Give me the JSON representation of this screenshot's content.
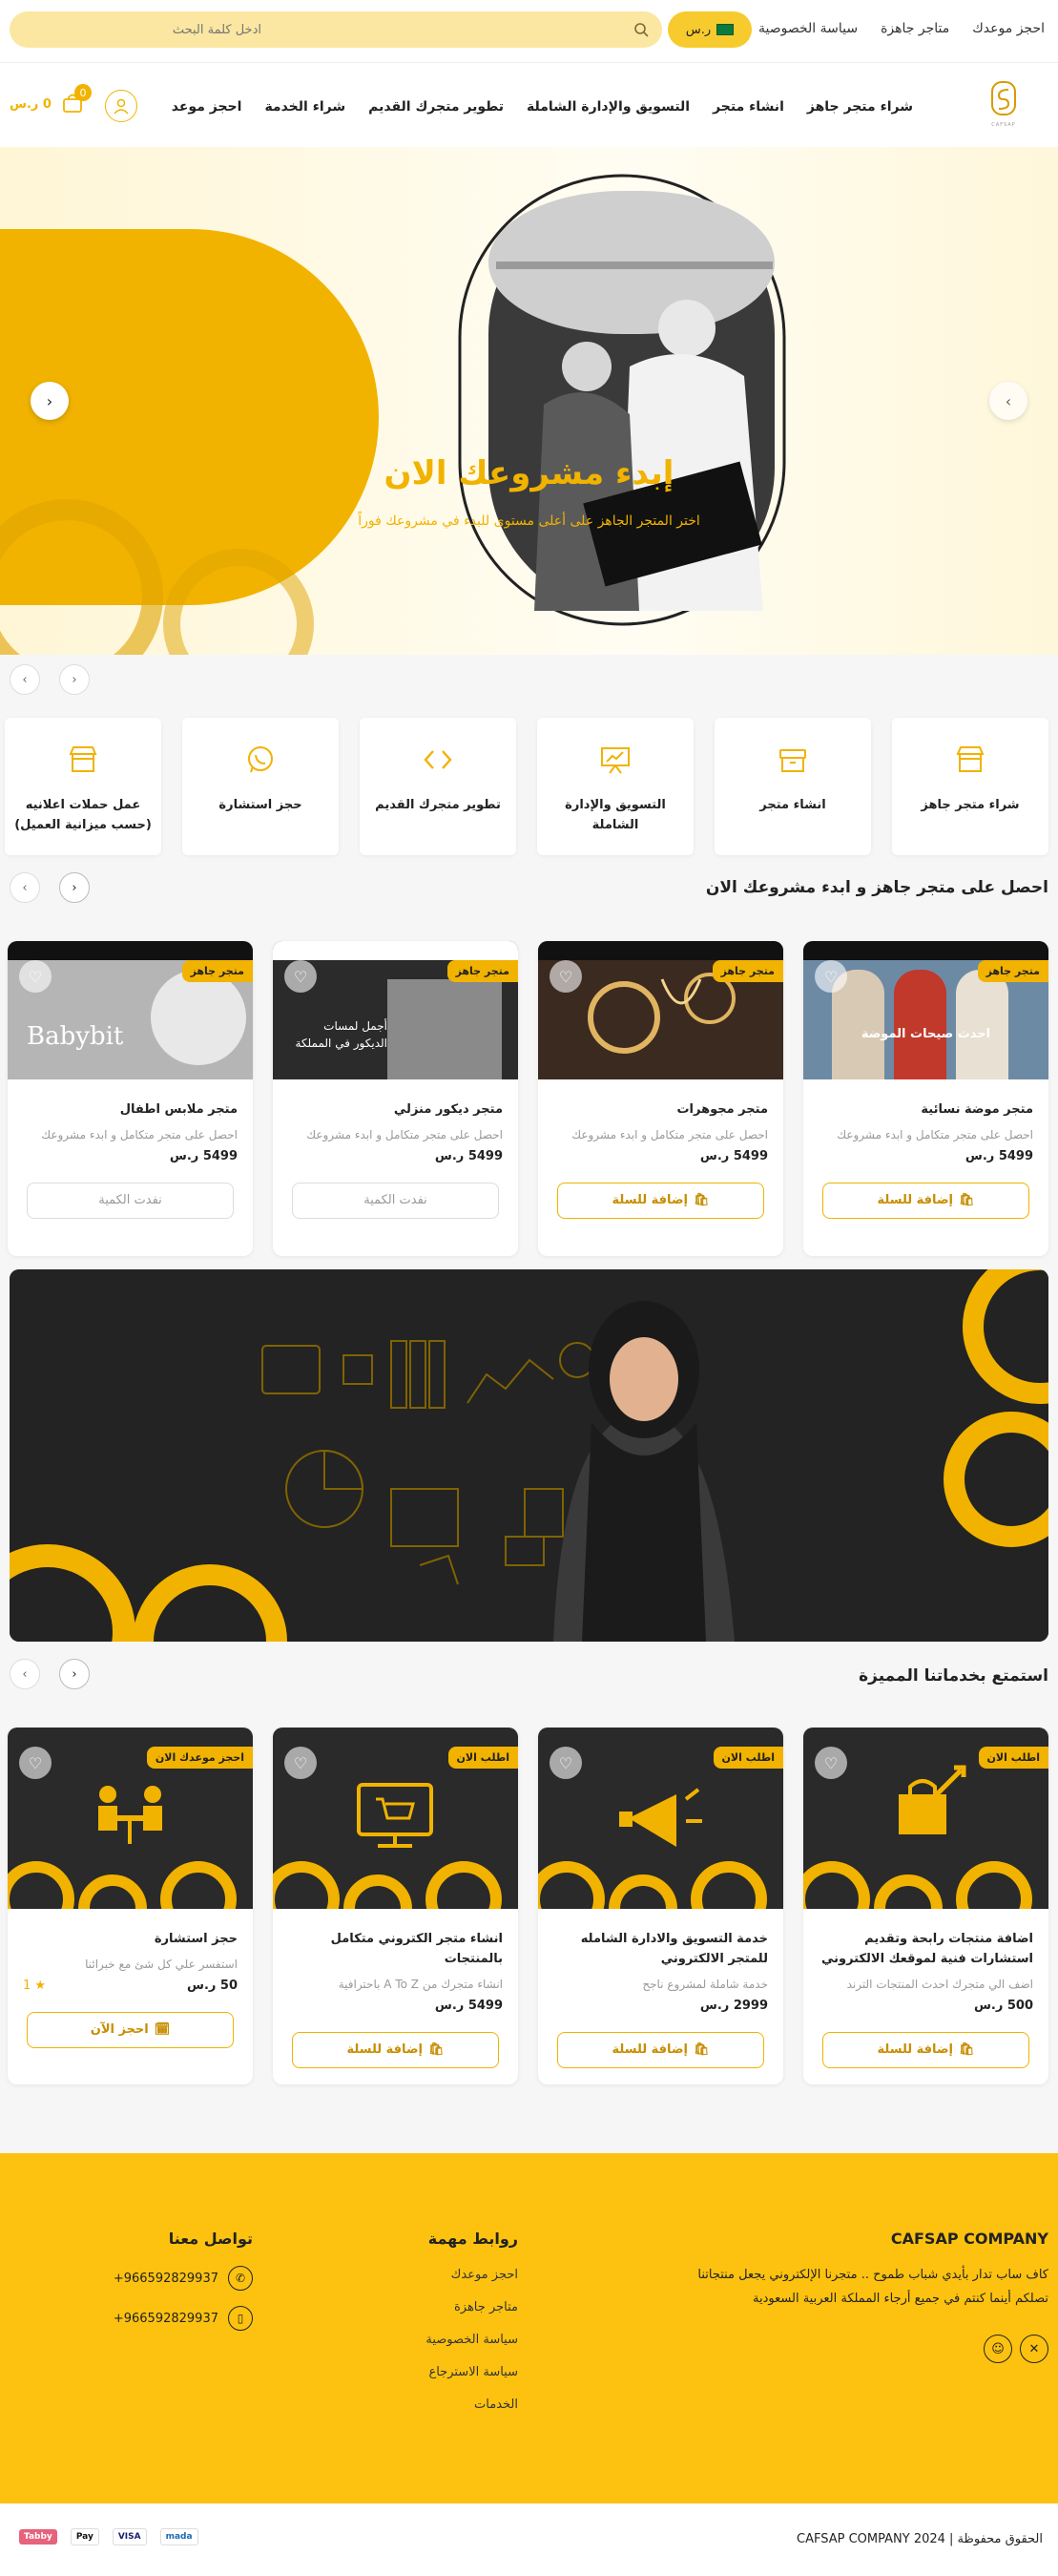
{
  "topbar": {
    "links": [
      "احجز موعدك",
      "متاجر جاهزة",
      "سياسة الخصوصية"
    ],
    "currency": "ر.س",
    "search_placeholder": "ادخل كلمة البحث"
  },
  "nav": {
    "logo_text": "CAFSAP",
    "links": [
      "شراء متجر جاهز",
      "انشاء متجر",
      "التسويق والإدارة الشاملة",
      "تطوير متجرك القديم",
      "شراء الخدمة",
      "احجز موعد"
    ],
    "cart_count": "0",
    "cart_total": "0 ر.س"
  },
  "hero": {
    "title": "إبدء مشروعك الان",
    "subtitle": "اختر المتجر الجاهز على أعلى مستوى للبدء في مشروعك فوراً"
  },
  "services": [
    {
      "label": "شراء متجر جاهز",
      "icon": "store-icon"
    },
    {
      "label": "انشاء متجر",
      "icon": "box-icon"
    },
    {
      "label": "التسويق والإدارة الشاملة",
      "icon": "presentation-icon"
    },
    {
      "label": "تطوير متجرك القديم",
      "icon": "code-icon"
    },
    {
      "label": "حجز استشارة",
      "icon": "whatsapp-icon"
    },
    {
      "label": "عمل حملات اعلانيه (حسب ميزانية العميل)",
      "icon": "store-icon"
    }
  ],
  "stores_section": {
    "title": "احصل على متجر جاهز و ابدء مشروعك الان",
    "products": [
      {
        "badge": "متجر جاهز",
        "name": "متجر موضة نسائية",
        "desc": "احصل على متجر متكامل و ابدء مشروعك",
        "price": "5499 ر.س",
        "button": "إضافة للسلة",
        "available": true,
        "img_text": "احدث صيحات الموضة"
      },
      {
        "badge": "متجر جاهز",
        "name": "متجر مجوهرات",
        "desc": "احصل على متجر متكامل و ابدء مشروعك",
        "price": "5499 ر.س",
        "button": "إضافة للسلة",
        "available": true,
        "img_text": ""
      },
      {
        "badge": "متجر جاهز",
        "name": "متجر ديكور منزلي",
        "desc": "احصل على متجر متكامل و ابدء مشروعك",
        "price": "5499 ر.س",
        "button": "نفدت الكمية",
        "available": false,
        "img_text": "أجمل لمسات الديكور في المملكة"
      },
      {
        "badge": "متجر جاهز",
        "name": "متجر ملابس اطفال",
        "desc": "احصل على متجر متكامل و ابدء مشروعك",
        "price": "5499 ر.س",
        "button": "نفدت الكمية",
        "available": false,
        "img_text": "Babybit"
      }
    ]
  },
  "services_section": {
    "title": "استمتع بخدماتنا المميزة",
    "products": [
      {
        "badge": "اطلب الان",
        "name": "اضافة منتجات رابحة وتقديم استشارات فنية لموقعك الالكتروني",
        "desc": "اضف الي متجرك احدث المنتجات الترند",
        "price": "500 ر.س",
        "button": "إضافة للسلة",
        "icon": "bag-chart-icon"
      },
      {
        "badge": "اطلب الان",
        "name": "خدمة التسويق والادارة الشامله للمتجر الالكتروني",
        "desc": "خدمة شاملة لمشروع ناجح",
        "price": "2999 ر.س",
        "button": "إضافة للسلة",
        "icon": "megaphone-icon"
      },
      {
        "badge": "اطلب الان",
        "name": "انشاء متجر الكتروني متكامل بالمنتجات",
        "desc": "انشاء متجرك من A To Z باحترافية",
        "price": "5499 ر.س",
        "button": "إضافة للسلة",
        "icon": "monitor-cart-icon"
      },
      {
        "badge": "احجز موعدك الان",
        "name": "حجز استشارة",
        "desc": "استفسر علي كل شئ مع خبرائنا",
        "price": "50 ر.س",
        "rating": "1",
        "button": "احجز الآن",
        "icon": "meeting-icon"
      }
    ]
  },
  "footer": {
    "company_title": "CAFSAP COMPANY",
    "about": "كاف ساب تدار بأيدي شباب طموح .. متجرنا الإلكتروني يجعل منتجاتنا تصلكم أينما كنتم في جميع أرجاء المملكة العربية السعودية",
    "links_title": "روابط مهمة",
    "links": [
      "احجز موعدك",
      "متاجر جاهزة",
      "سياسة الخصوصية",
      "سياسة الاسترجاع",
      "الخدمات"
    ],
    "contact_title": "تواصل معنا",
    "whatsapp": "+966592829937",
    "phone": "+966592829937",
    "copyright": "الحقوق محفوظة | CAFSAP COMPANY 2024",
    "payments": [
      "mada",
      "VISA",
      "Pay",
      "Tabby"
    ]
  },
  "colors": {
    "accent": "#f1b300",
    "footer": "#fdc20f"
  }
}
